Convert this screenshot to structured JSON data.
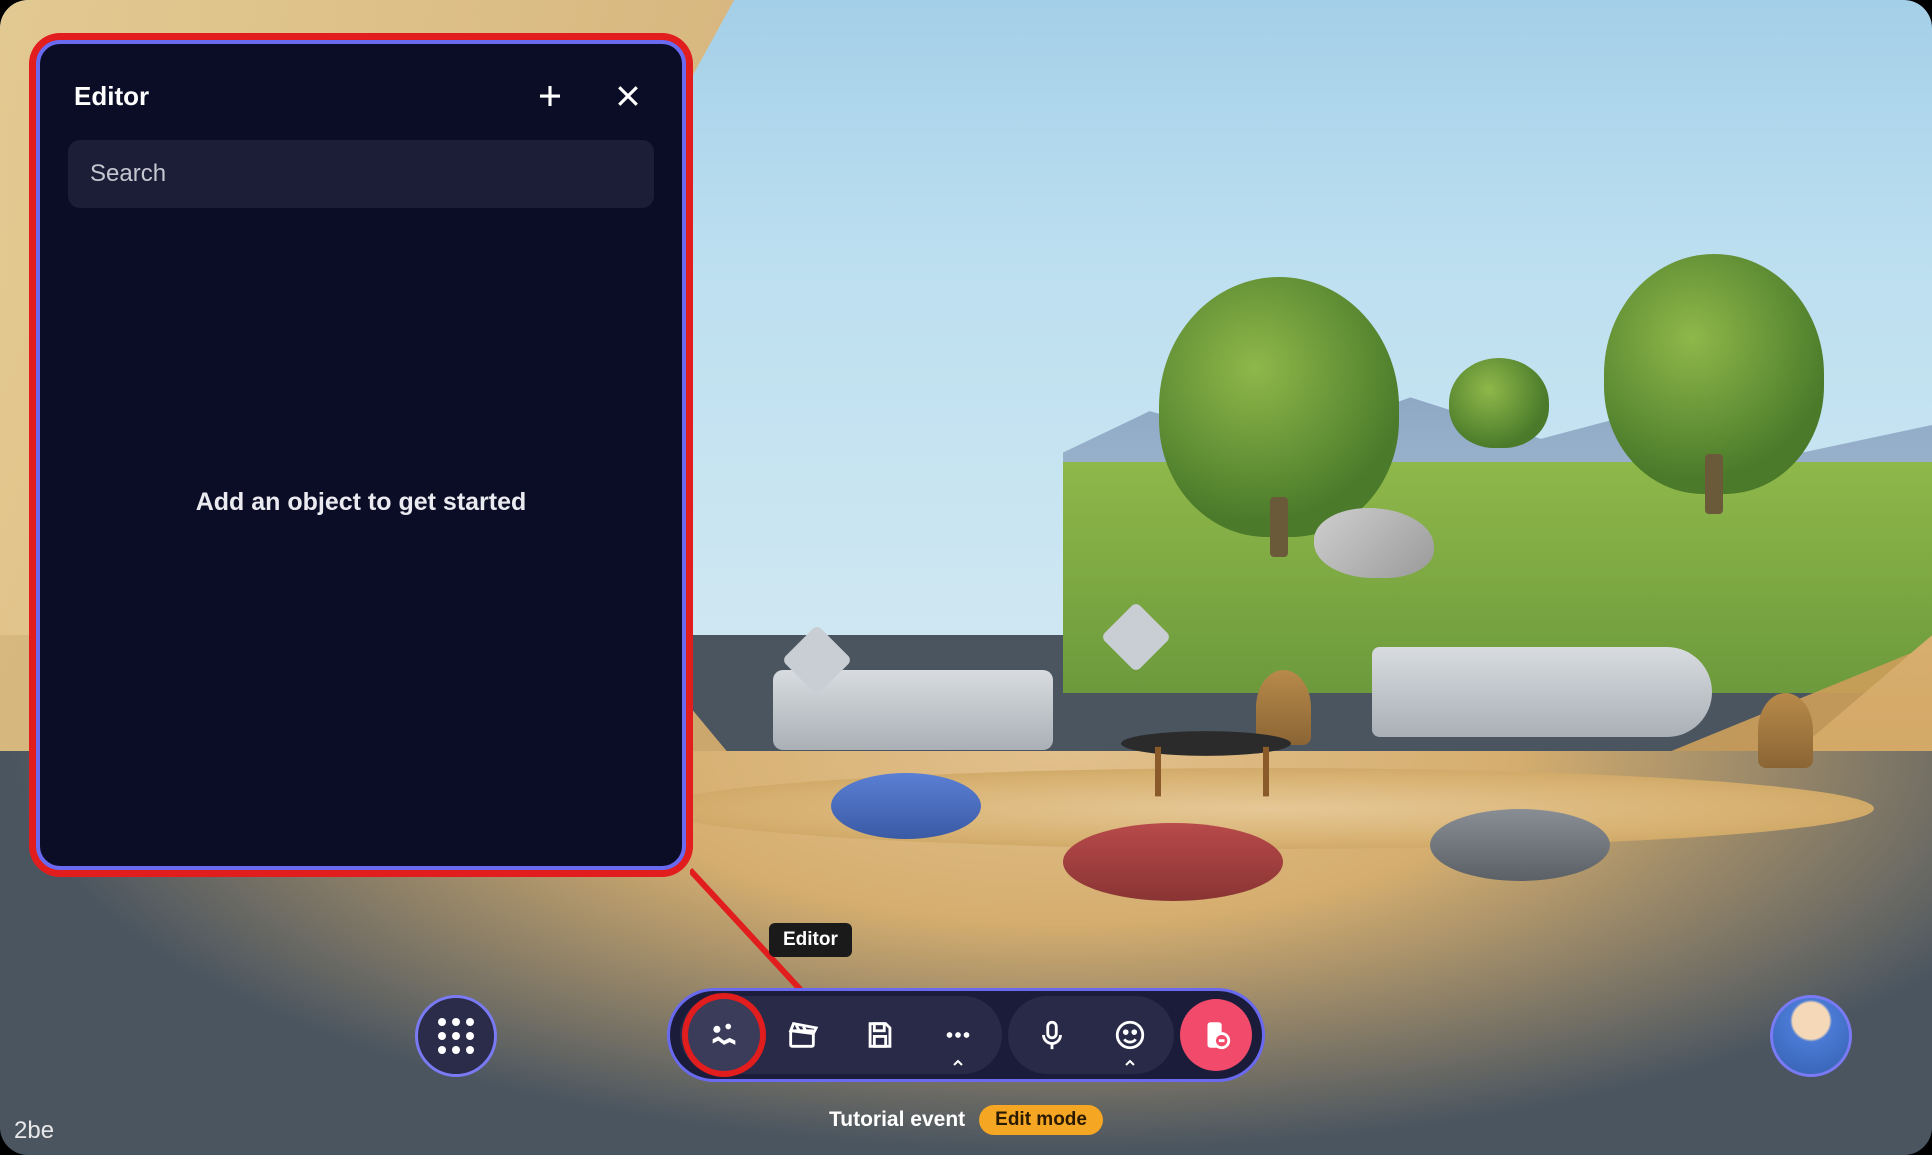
{
  "editor": {
    "title": "Editor",
    "search_placeholder": "Search",
    "empty_message": "Add an object to get started"
  },
  "tooltip": {
    "editor": "Editor"
  },
  "toolbar": {
    "editor_btn": "editor",
    "action_btn": "action",
    "save_btn": "save",
    "more_btn": "more",
    "mic_btn": "microphone",
    "react_btn": "reactions",
    "leave_btn": "leave"
  },
  "status": {
    "event_name": "Tutorial event",
    "mode_label": "Edit mode"
  },
  "corner_code": "2be",
  "colors": {
    "highlight": "#e11d1d",
    "panel_border": "#6a6af0",
    "panel_bg": "#0b0d26",
    "toolbar_bg": "#1a1c3a",
    "leave_btn": "#f14a6a",
    "mode_pill": "#f5a623"
  }
}
